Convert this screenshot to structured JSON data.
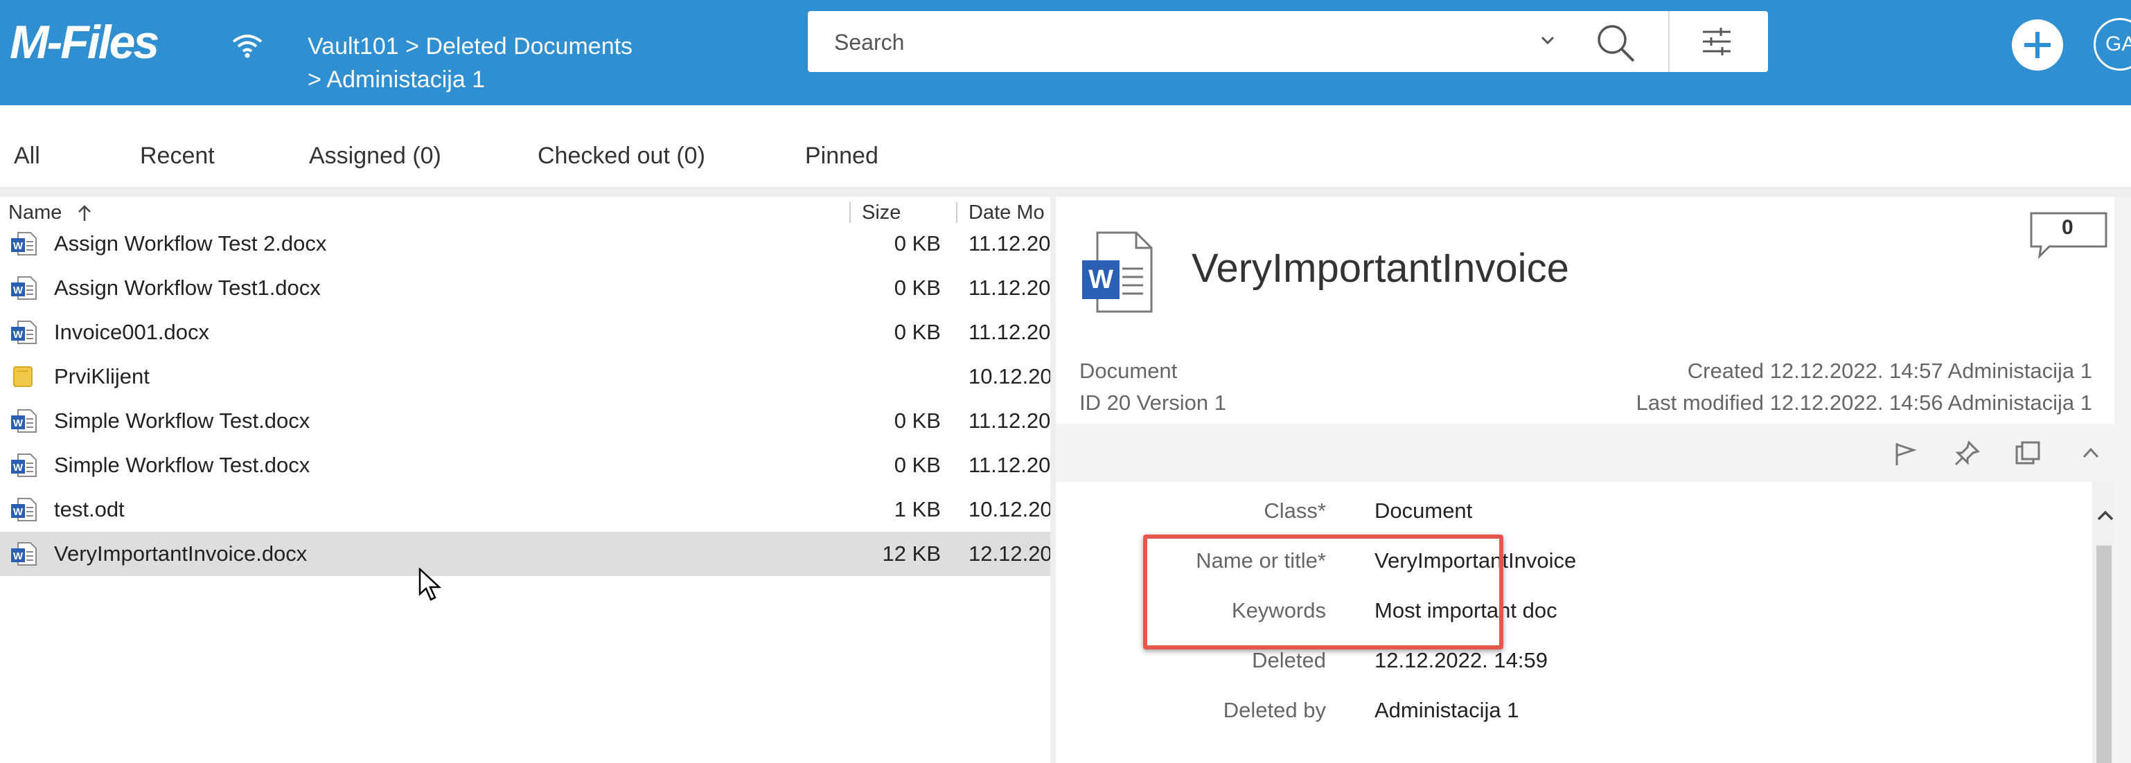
{
  "header": {
    "logo": "M-Files",
    "breadcrumb_line1": "Vault101 > Deleted Documents",
    "breadcrumb_line2": "> Administacija 1",
    "search_placeholder": "Search",
    "avatar_initials": "GA",
    "brand_color": "#2f8fd1"
  },
  "tabs": [
    {
      "label": "All"
    },
    {
      "label": "Recent"
    },
    {
      "label": "Assigned (0)"
    },
    {
      "label": "Checked out (0)"
    },
    {
      "label": "Pinned"
    }
  ],
  "list": {
    "columns": {
      "name": "Name",
      "size": "Size",
      "date": "Date Mo"
    },
    "sort_indicator": "arrow-up-icon",
    "rows": [
      {
        "name": "Assign Workflow Test 2.docx",
        "size": "0 KB",
        "date": "11.12.20",
        "icon": "word-file-icon"
      },
      {
        "name": "Assign Workflow Test1.docx",
        "size": "0 KB",
        "date": "11.12.20",
        "icon": "word-file-icon"
      },
      {
        "name": "Invoice001.docx",
        "size": "0 KB",
        "date": "11.12.20",
        "icon": "word-file-icon"
      },
      {
        "name": "PrviKlijent",
        "size": "",
        "date": "10.12.20",
        "icon": "folder-icon"
      },
      {
        "name": "Simple Workflow Test.docx",
        "size": "0 KB",
        "date": "11.12.20",
        "icon": "word-file-icon"
      },
      {
        "name": "Simple Workflow Test.docx",
        "size": "0 KB",
        "date": "11.12.20",
        "icon": "word-file-icon"
      },
      {
        "name": "test.odt",
        "size": "1 KB",
        "date": "10.12.20",
        "icon": "word-file-icon"
      },
      {
        "name": "VeryImportantInvoice.docx",
        "size": "12 KB",
        "date": "12.12.20",
        "icon": "word-file-icon",
        "selected": true
      }
    ]
  },
  "details": {
    "title": "VeryImportantInvoice",
    "comment_count": "0",
    "type": "Document",
    "id_version": "ID 20  Version 1",
    "created": "Created 12.12.2022. 14:57 Administacija 1",
    "last_modified": "Last modified 12.12.2022. 14:56 Administacija 1",
    "properties": [
      {
        "label": "Class",
        "required": "*",
        "value": "Document"
      },
      {
        "label": "Name or title",
        "required": "*",
        "value": "VeryImportantInvoice"
      },
      {
        "label": "Keywords",
        "required": "",
        "value": "Most important doc"
      },
      {
        "label": "Deleted",
        "required": "",
        "value": "12.12.2022. 14:59"
      },
      {
        "label": "Deleted by",
        "required": "",
        "value": "Administacija 1"
      }
    ],
    "highlight_color": "#e5574c"
  }
}
